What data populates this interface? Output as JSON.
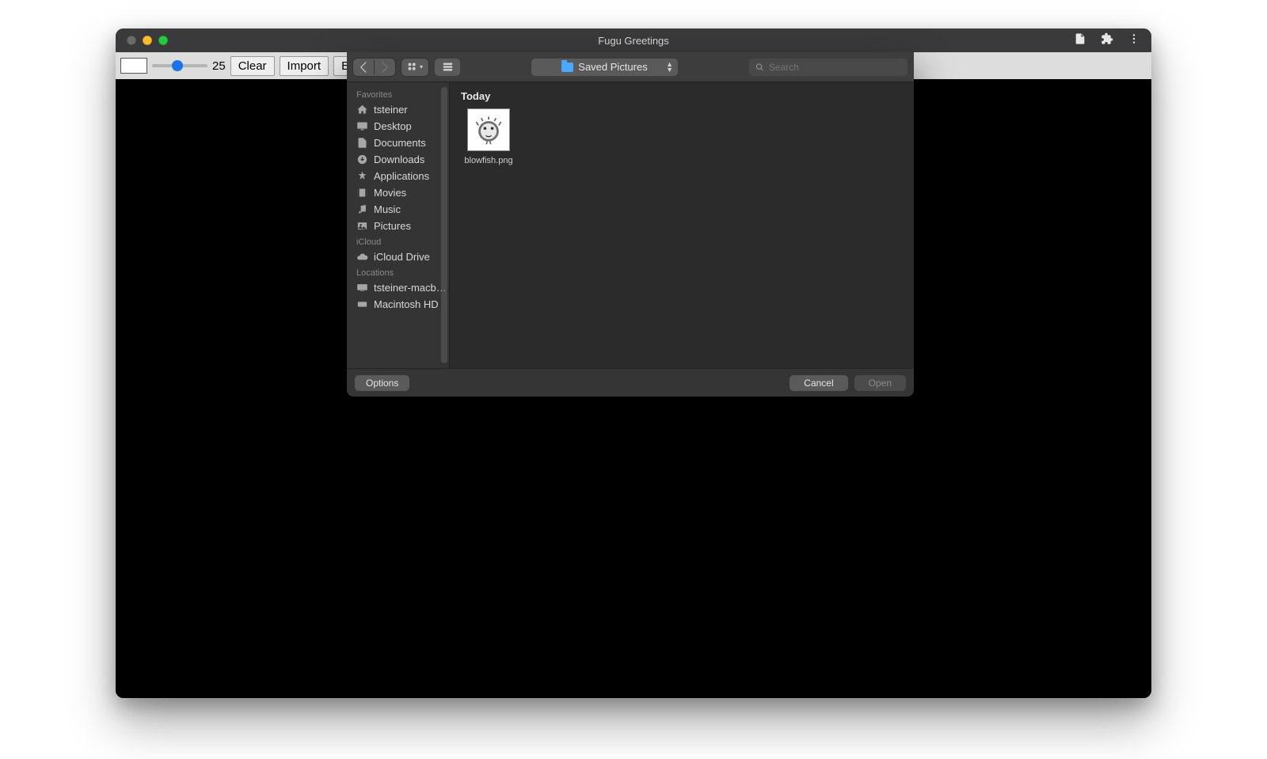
{
  "window": {
    "title": "Fugu Greetings"
  },
  "title_actions": {
    "document_tooltip": "Document",
    "extensions_tooltip": "Extensions",
    "menu_tooltip": "More"
  },
  "app_toolbar": {
    "slider_value": "25",
    "clear_label": "Clear",
    "import_label": "Import",
    "export_label_clipped": "Expo"
  },
  "file_picker": {
    "location_label": "Saved Pictures",
    "search_placeholder": "Search",
    "group_header": "Today",
    "files": [
      {
        "name": "blowfish.png"
      }
    ],
    "sidebar": {
      "favorites_header": "Favorites",
      "favorites": [
        {
          "icon": "home",
          "label": "tsteiner"
        },
        {
          "icon": "desktop",
          "label": "Desktop"
        },
        {
          "icon": "document",
          "label": "Documents"
        },
        {
          "icon": "download",
          "label": "Downloads"
        },
        {
          "icon": "apps",
          "label": "Applications"
        },
        {
          "icon": "movies",
          "label": "Movies"
        },
        {
          "icon": "music",
          "label": "Music"
        },
        {
          "icon": "pictures",
          "label": "Pictures"
        }
      ],
      "icloud_header": "iCloud",
      "icloud": [
        {
          "icon": "cloud",
          "label": "iCloud Drive"
        }
      ],
      "locations_header": "Locations",
      "locations": [
        {
          "icon": "laptop",
          "label": "tsteiner-macb…"
        },
        {
          "icon": "disk",
          "label": "Macintosh HD"
        }
      ]
    },
    "footer": {
      "options_label": "Options",
      "cancel_label": "Cancel",
      "open_label": "Open"
    }
  }
}
